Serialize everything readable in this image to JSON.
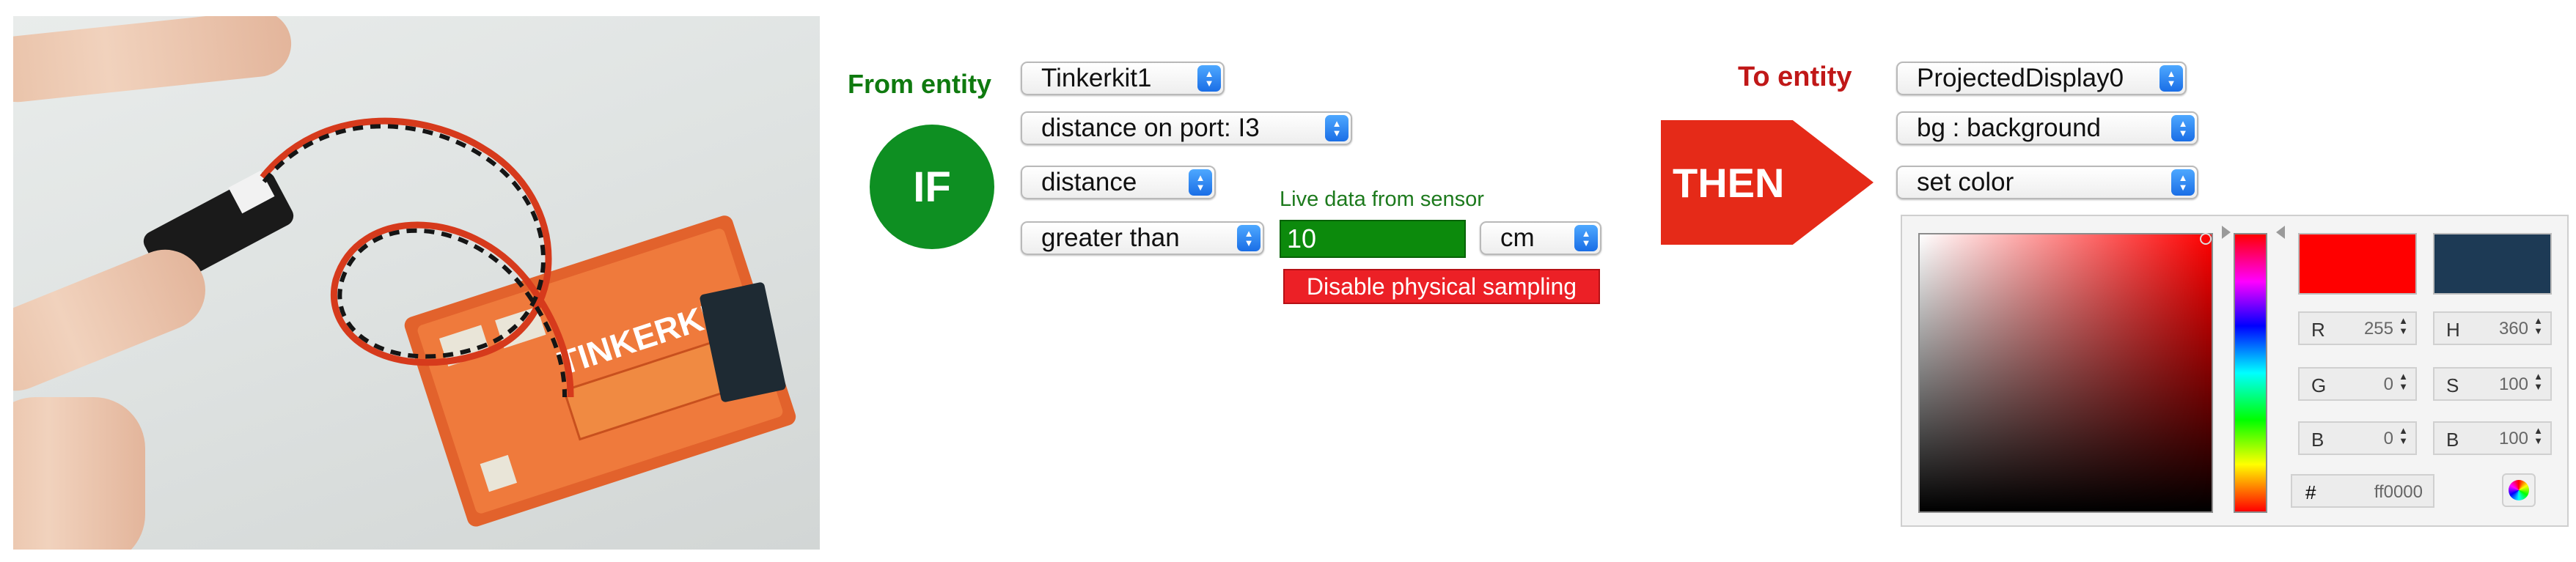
{
  "if_panel": {
    "from_label": "From entity",
    "entity_select": "Tinkerkit1",
    "port_select": "distance on port: I3",
    "property_select": "distance",
    "operator_select": "greater than",
    "if_label": "IF",
    "live_label": "Live data from sensor",
    "live_value": "10",
    "unit_select": "cm",
    "disable_button": "Disable physical sampling"
  },
  "then_panel": {
    "then_label": "THEN",
    "to_label": "To entity",
    "entity_select": "ProjectedDisplay0",
    "target_select": "bg : background",
    "action_select": "set color"
  },
  "color_picker": {
    "new_color": "#ff0000",
    "old_color": "#1d3a55",
    "hue_position": 0.0,
    "r_label": "R",
    "r_value": "255",
    "g_label": "G",
    "g_value": "0",
    "b_label": "B",
    "b_value": "0",
    "h_label": "H",
    "h_value": "360",
    "s_label": "S",
    "s_value": "100",
    "bright_label": "B",
    "bright_value": "100",
    "hex_label": "#",
    "hex_value": "ff0000"
  },
  "icons": {
    "select_arrows": "updown-arrows-icon",
    "color_wheel": "color-wheel-icon"
  }
}
